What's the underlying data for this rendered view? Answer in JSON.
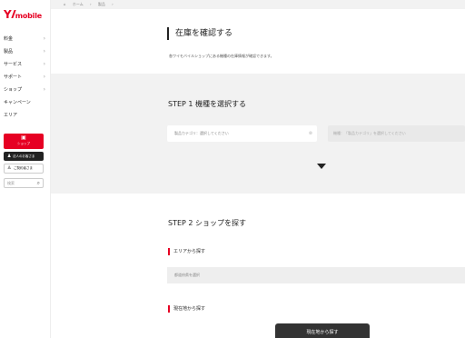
{
  "logo": {
    "y": "Y",
    "word": "mobile"
  },
  "nav": [
    {
      "label": "料金",
      "chevron": "›"
    },
    {
      "label": "製品",
      "chevron": "›"
    },
    {
      "label": "サービス",
      "chevron": "›"
    },
    {
      "label": "サポート",
      "chevron": "›"
    },
    {
      "label": "ショップ",
      "chevron": "›"
    },
    {
      "label": "キャンペーン",
      "chevron": ""
    },
    {
      "label": "エリア",
      "chevron": ""
    }
  ],
  "side_buttons": {
    "shop_icon": "▣",
    "shop_label": "ショップ",
    "corp_icon": "♟",
    "corp_label": "法人のお客さま",
    "member_icon": "♙",
    "member_label": "ご契約者さま",
    "search_placeholder": "検索",
    "search_icon": "⌕"
  },
  "breadcrumb": {
    "home_icon": "⌂",
    "home": "ホーム",
    "sep": "›",
    "current": "製品"
  },
  "page": {
    "title": "在庫を確認する",
    "description": "各ワイモバイルショップにある機種の在庫情報が確認できます。"
  },
  "step1": {
    "title": "STEP 1 機種を選択する",
    "select_category": "製品カテゴリ：選択してください",
    "clear_icon": "⊗",
    "select_model": "機種：「製品カテゴリ」を選択してください"
  },
  "step2": {
    "title": "STEP 2 ショップを探す",
    "area_heading": "エリアから探す",
    "area_select": "都道府県を選択",
    "location_heading": "現在地から探す",
    "location_button": "現在地から探す"
  }
}
